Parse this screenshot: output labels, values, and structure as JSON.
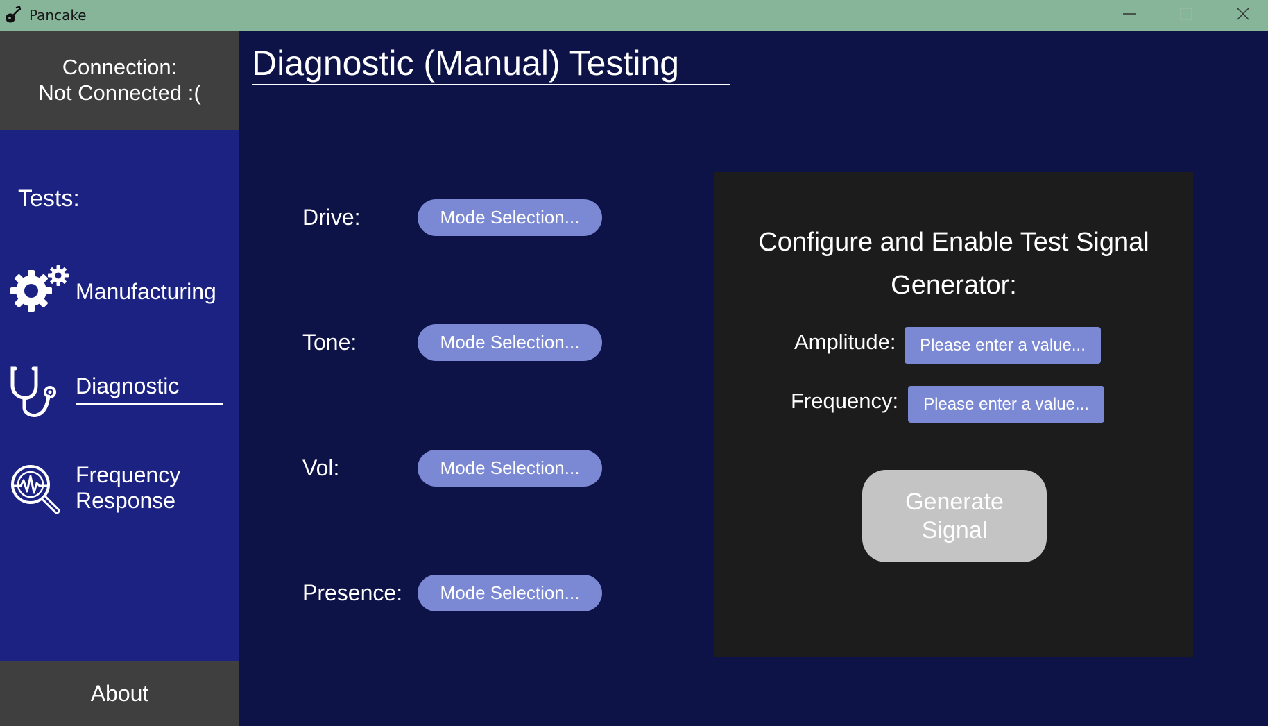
{
  "window": {
    "title": "Pancake",
    "app_icon": "guitar-icon",
    "controls": [
      "minimize-icon",
      "maximize-icon",
      "close-icon"
    ]
  },
  "sidebar": {
    "connection": {
      "label": "Connection:",
      "status": "Not Connected :("
    },
    "tests_heading": "Tests:",
    "items": [
      {
        "label": "Manufacturing",
        "icon": "gears-icon",
        "active": false
      },
      {
        "label": "Diagnostic",
        "icon": "stethoscope-icon",
        "active": true
      },
      {
        "label_line1": "Frequency",
        "label_line2": "Response",
        "icon": "magnifier-waveform-icon",
        "active": false
      }
    ],
    "about": "About"
  },
  "main": {
    "title": "Diagnostic (Manual) Testing",
    "controls": [
      {
        "label": "Drive:",
        "button": "Mode Selection..."
      },
      {
        "label": "Tone:",
        "button": "Mode Selection..."
      },
      {
        "label": "Vol:",
        "button": "Mode Selection..."
      },
      {
        "label": "Presence:",
        "button": "Mode Selection..."
      }
    ]
  },
  "signal_generator": {
    "title_line1": "Configure and Enable Test Signal",
    "title_line2": "Generator:",
    "amplitude_label": "Amplitude:",
    "amplitude_placeholder": "Please enter a value...",
    "frequency_label": "Frequency:",
    "frequency_placeholder": "Please enter a value...",
    "generate_line1": "Generate",
    "generate_line2": "Signal"
  },
  "colors": {
    "titlebar": "#86b59a",
    "background": "#0e1347",
    "sidebar_tests": "#1b2282",
    "sidebar_dark": "#3f3f3f",
    "button": "#7b88d3",
    "panel": "#1c1c1c",
    "disabled_button": "#c4c4c4"
  }
}
